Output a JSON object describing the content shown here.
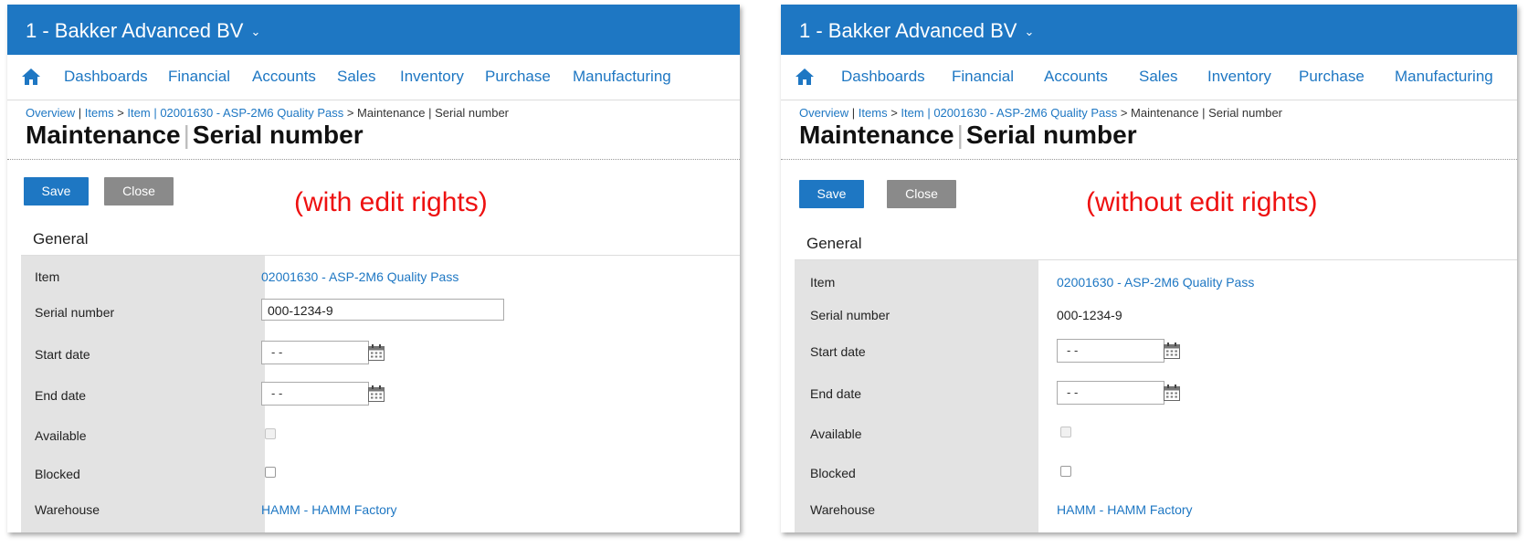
{
  "panels": [
    {
      "company": "1 - Bakker Advanced BV",
      "nav": [
        "Dashboards",
        "Financial",
        "Accounts",
        "Sales",
        "Inventory",
        "Purchase",
        "Manufacturing"
      ],
      "breadcrumb": {
        "overview": "Overview",
        "items": "Items",
        "item": "Item",
        "item_code": "02001630 - ASP-2M6 Quality Pass",
        "current": "Maintenance | Serial number"
      },
      "title_main": "Maintenance",
      "title_sub": "Serial number",
      "save_label": "Save",
      "close_label": "Close",
      "annotation": "(with edit rights)",
      "section": "General",
      "labels": {
        "item": "Item",
        "serial": "Serial number",
        "start": "Start date",
        "end": "End date",
        "available": "Available",
        "blocked": "Blocked",
        "warehouse": "Warehouse"
      },
      "values": {
        "item": "02001630 - ASP-2M6 Quality Pass",
        "serial": "000-1234-9",
        "start": "- -",
        "end": "- -",
        "warehouse": "HAMM - HAMM Factory"
      }
    },
    {
      "company": "1 - Bakker Advanced BV",
      "nav": [
        "Dashboards",
        "Financial",
        "Accounts",
        "Sales",
        "Inventory",
        "Purchase",
        "Manufacturing"
      ],
      "breadcrumb": {
        "overview": "Overview",
        "items": "Items",
        "item": "Item",
        "item_code": "02001630 - ASP-2M6 Quality Pass",
        "current": "Maintenance | Serial number"
      },
      "title_main": "Maintenance",
      "title_sub": "Serial number",
      "save_label": "Save",
      "close_label": "Close",
      "annotation": "(without edit rights)",
      "section": "General",
      "labels": {
        "item": "Item",
        "serial": "Serial number",
        "start": "Start date",
        "end": "End date",
        "available": "Available",
        "blocked": "Blocked",
        "warehouse": "Warehouse"
      },
      "values": {
        "item": "02001630 - ASP-2M6 Quality Pass",
        "serial": "000-1234-9",
        "start": "- -",
        "end": "- -",
        "warehouse": "HAMM - HAMM Factory"
      }
    }
  ],
  "colors": {
    "topbar": "#1e77c3",
    "link": "#1e77c3",
    "save_button": "#1e77c3",
    "close_button": "#8a8a8a",
    "annotation": "#ee1111",
    "label_column": "#e3e3e3"
  },
  "icons": [
    "home-icon",
    "chevron-down-icon",
    "calendar-icon"
  ]
}
